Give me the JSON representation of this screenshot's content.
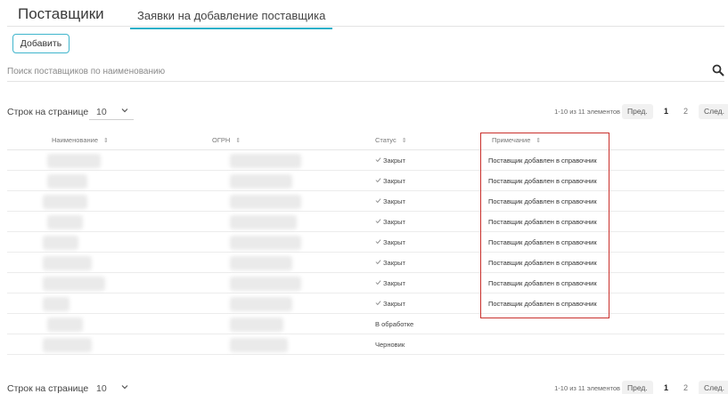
{
  "tabs": {
    "main": "Поставщики",
    "requests": "Заявки на добавление поставщика"
  },
  "toolbar": {
    "add_label": "Добавить"
  },
  "search": {
    "placeholder": "Поиск поставщиков по наименованию",
    "icon": "search-icon"
  },
  "pager": {
    "rows_label": "Строк на странице",
    "rows_value": "10",
    "range": "1-10 из 11 элементов",
    "prev": "Пред.",
    "next": "След.",
    "pages": [
      "1",
      "2"
    ],
    "current_page": "1"
  },
  "table": {
    "headers": {
      "name": "Наименование",
      "ogrn": "ОГРН",
      "status": "Статус",
      "note": "Примечание"
    },
    "rows": [
      {
        "status": "Закрыт",
        "status_checked": true,
        "note": "Поставщик добавлен в справочник"
      },
      {
        "status": "Закрыт",
        "status_checked": true,
        "note": "Поставщик добавлен в справочник"
      },
      {
        "status": "Закрыт",
        "status_checked": true,
        "note": "Поставщик добавлен в справочник"
      },
      {
        "status": "Закрыт",
        "status_checked": true,
        "note": "Поставщик добавлен в справочник"
      },
      {
        "status": "Закрыт",
        "status_checked": true,
        "note": "Поставщик добавлен в справочник"
      },
      {
        "status": "Закрыт",
        "status_checked": true,
        "note": "Поставщик добавлен в справочник"
      },
      {
        "status": "Закрыт",
        "status_checked": true,
        "note": "Поставщик добавлен в справочник"
      },
      {
        "status": "Закрыт",
        "status_checked": true,
        "note": "Поставщик добавлен в справочник"
      },
      {
        "status": "В обработке",
        "status_checked": false,
        "note": ""
      },
      {
        "status": "Черновик",
        "status_checked": false,
        "note": ""
      }
    ]
  },
  "colors": {
    "accent": "#27b0c9",
    "highlight": "#c9302c"
  }
}
